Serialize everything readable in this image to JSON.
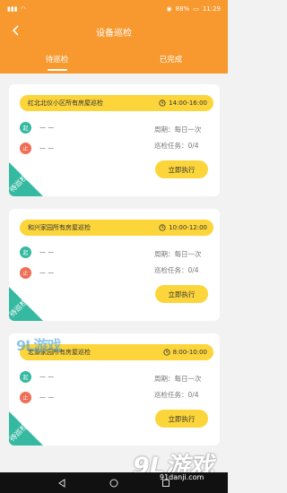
{
  "status_bar": {
    "battery": "88%",
    "time": "11:29"
  },
  "header": {
    "title": "设备巡检",
    "back_icon": "chevron-left-icon"
  },
  "tabs": [
    {
      "label": "待巡检",
      "active": true
    },
    {
      "label": "已完成",
      "active": false
    }
  ],
  "labels": {
    "period_label": "周期：",
    "task_label": "巡检任务：",
    "start_dot": "起",
    "end_dot": "止",
    "ribbon_text": "待巡检",
    "exec_button": "立即执行"
  },
  "cards": [
    {
      "name": "红北北仪小区所有房屋巡检",
      "time": "14:00-16:00",
      "start_point": "— —",
      "end_point": "— —",
      "period": "每日一次",
      "progress": "0/4"
    },
    {
      "name": "和兴家园所有房屋巡检",
      "time": "10:00-12:00",
      "start_point": "— —",
      "end_point": "— —",
      "period": "每日一次",
      "progress": "0/4"
    },
    {
      "name": "宏源家园所有房屋巡检",
      "time": "8:00-10:00",
      "start_point": "— —",
      "end_point": "— —",
      "period": "每日一次",
      "progress": "0/4"
    }
  ],
  "watermark": {
    "top": "9L游戏",
    "logo": "9L游戏",
    "site": "91danji.com"
  },
  "colors": {
    "accent": "#f7992f",
    "button": "#fcd53b",
    "start": "#35b9a0",
    "end": "#ef6e55",
    "ribbon": "#35b9a0"
  }
}
